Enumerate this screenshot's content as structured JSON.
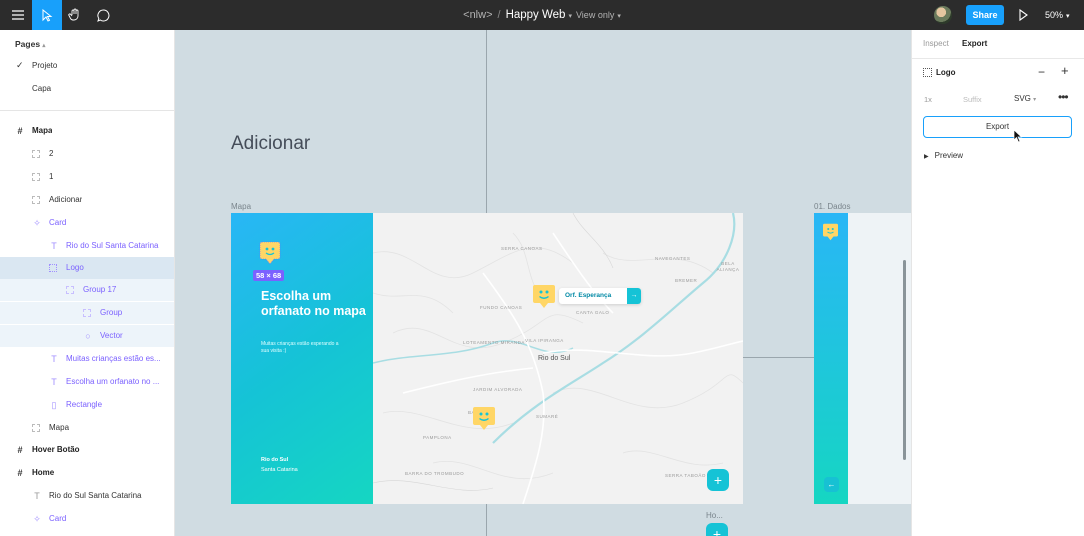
{
  "toolbar": {
    "project": "<nlw>",
    "separator": "/",
    "file_name": "Happy Web",
    "mode": "View only",
    "share_label": "Share",
    "zoom": "50%",
    "colors": {
      "bg": "#2c2c2c",
      "accent": "#18a0fb"
    }
  },
  "left_panel": {
    "pages_header": "Pages",
    "pages": [
      {
        "label": "Projeto",
        "current": true
      },
      {
        "label": "Capa",
        "current": false
      }
    ],
    "layers": [
      {
        "label": "Mapa",
        "icon": "frame-icon"
      },
      {
        "label": "2",
        "icon": "frame-dashed-icon"
      },
      {
        "label": "1",
        "icon": "frame-dashed-icon"
      },
      {
        "label": "Adicionar",
        "icon": "frame-dashed-icon"
      },
      {
        "label": "Card",
        "icon": "component-icon"
      },
      {
        "label": "Rio do Sul Santa Catarina",
        "icon": "text-icon"
      },
      {
        "label": "Logo",
        "icon": "frame-dotted-icon"
      },
      {
        "label": "Group 17",
        "icon": "group-icon"
      },
      {
        "label": "Group",
        "icon": "group-icon"
      },
      {
        "label": "Vector",
        "icon": "vector-icon"
      },
      {
        "label": "Muitas crianças estão es...",
        "icon": "text-icon"
      },
      {
        "label": "Escolha um orfanato no ...",
        "icon": "text-icon"
      },
      {
        "label": "Rectangle",
        "icon": "rectangle-icon"
      },
      {
        "label": "Mapa",
        "icon": "frame-dashed-icon"
      },
      {
        "label": "Hover Botão",
        "icon": "frame-icon"
      },
      {
        "label": "Home",
        "icon": "frame-icon"
      },
      {
        "label": "Rio do Sul Santa Catarina",
        "icon": "text-icon"
      },
      {
        "label": "Card",
        "icon": "component-icon"
      }
    ]
  },
  "canvas": {
    "heading": "Adicionar",
    "frame_labels": {
      "mapa": "Mapa",
      "dados": "01. Dados",
      "home": "Ho..."
    },
    "mapa": {
      "dimension_badge": "58 × 68",
      "headline": "Escolha um orfanato no mapa",
      "subtitle": "Muitas crianças estão esperando a sua visita :)",
      "city": "Rio do Sul",
      "state": "Santa Catarina",
      "popup_text": "Orf. Esperança",
      "popup_arrow": "→",
      "fab_plus": "+",
      "map_city_label": "Rio do Sul",
      "map_labels": [
        "SERRA CANOAS",
        "NAVEGANTES",
        "BELA ALIANÇA",
        "BREMER",
        "FUNDO CANOAS",
        "CANTA GALO",
        "LOTEAMENTO MIRANDA",
        "VILA IPIRANGA",
        "JARDIM ALVORADA",
        "BARRA",
        "SUMARÉ",
        "PAMPLONA",
        "BARRA DO TROMBUDO",
        "SERRA TABOÃO"
      ],
      "colors": {
        "gradient_start": "#29b6f6",
        "gradient_end": "#15d6c2",
        "pin": "#ffd666",
        "map_bg": "#f2f2f2"
      }
    },
    "dados": {
      "back_arrow": "←"
    },
    "home": {
      "fab_plus": "+"
    }
  },
  "right_panel": {
    "tab_inspect": "Inspect",
    "tab_export": "Export",
    "layer_name": "Logo",
    "minus": "−",
    "plus": "+",
    "scale": "1x",
    "suffix_placeholder": "Suffix",
    "format": "SVG",
    "more": "•••",
    "export_button": "Export",
    "preview_label": "Preview"
  }
}
